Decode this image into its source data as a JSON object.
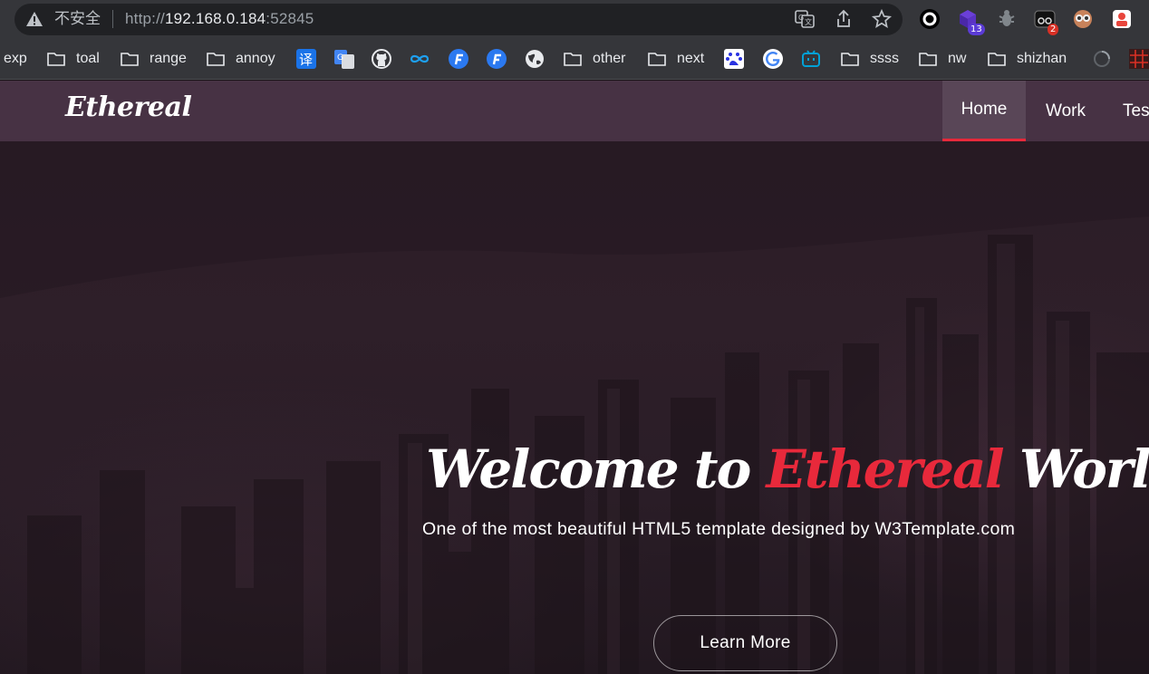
{
  "browser": {
    "security_label": "不安全",
    "url_scheme": "http://",
    "url_host": "192.168.0.184",
    "url_port": ":52845",
    "extension_badges": {
      "ext2": "13",
      "ext4": "2"
    }
  },
  "bookmarks": [
    {
      "label": "exp",
      "type": "text"
    },
    {
      "label": "toal",
      "type": "folder"
    },
    {
      "label": "range",
      "type": "folder"
    },
    {
      "label": "annoy",
      "type": "folder"
    },
    {
      "label": "other",
      "type": "folder"
    },
    {
      "label": "next",
      "type": "folder"
    },
    {
      "label": "ssss",
      "type": "folder"
    },
    {
      "label": "nw",
      "type": "folder"
    },
    {
      "label": "shizhan",
      "type": "folder"
    }
  ],
  "bookmark_icons": {
    "translate": "译"
  },
  "site": {
    "logo": "Ethereal",
    "nav": [
      {
        "label": "Home",
        "active": true
      },
      {
        "label": "Work",
        "active": false
      },
      {
        "label": "Tes",
        "active": false
      }
    ],
    "hero": {
      "title_part1": "Welcome to ",
      "title_accent": "Ethereal",
      "title_part2": " World",
      "subtitle": "One of the most beautiful HTML5 template designed by W3Template.com",
      "button": "Learn More"
    },
    "accent_color": "#e8293b"
  }
}
